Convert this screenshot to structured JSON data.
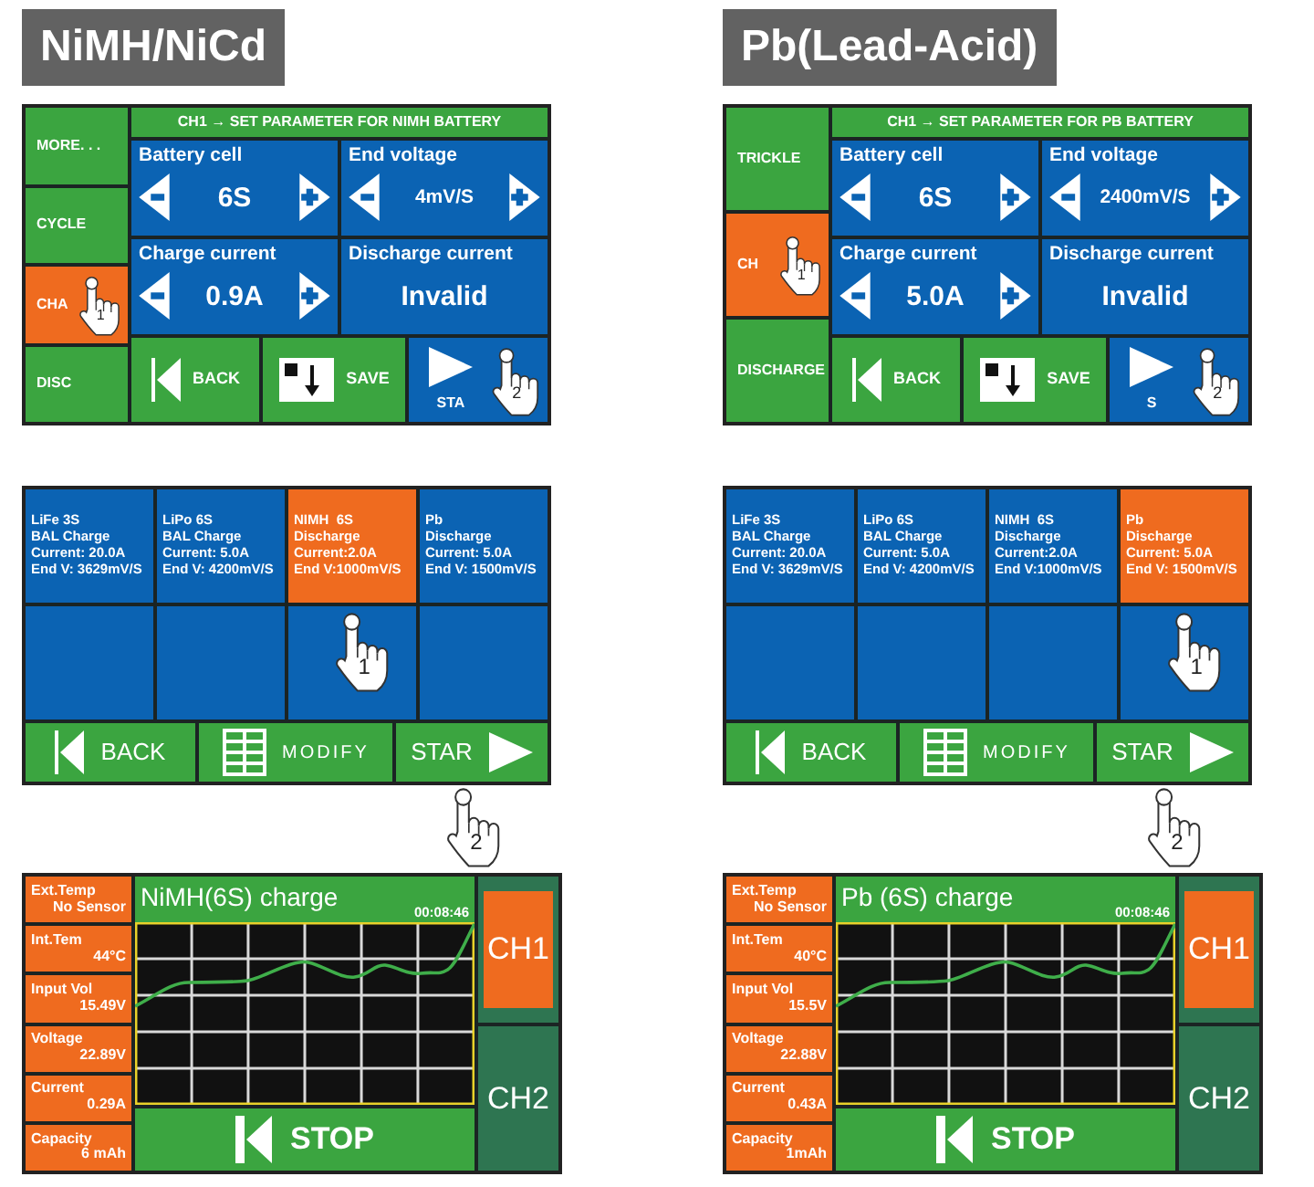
{
  "panels": [
    {
      "heading": "NiMH/NiCd",
      "setup": {
        "header": "CH1 → SET PARAMETER FOR NIMH BATTERY",
        "modes": [
          {
            "label": "MORE. . .",
            "selected": false
          },
          {
            "label": "CYCLE",
            "selected": false
          },
          {
            "label": "CHA",
            "selected": true,
            "step": "1"
          },
          {
            "label": "DISC",
            "selected": false
          }
        ],
        "parameters": [
          {
            "kind": "stepper",
            "label": "Battery cell",
            "value": "6S"
          },
          {
            "kind": "stepper",
            "label": "End voltage",
            "value": "4mV/S"
          },
          {
            "kind": "stepper",
            "label": "Charge current",
            "value": "0.9A"
          },
          {
            "kind": "readout",
            "label": "Discharge current",
            "value": "Invalid"
          }
        ],
        "buttons": [
          {
            "kind": "back",
            "label": "BACK"
          },
          {
            "kind": "save",
            "label": "SAVE"
          },
          {
            "kind": "start",
            "label": "STA",
            "step": "2"
          }
        ]
      },
      "programs": {
        "slots": [
          {
            "lines": [
              "LiFe 3S",
              "BAL Charge",
              "Current: 20.0A",
              "End V: 3629mV/S"
            ],
            "selected": false
          },
          {
            "lines": [
              "LiPo 6S",
              "BAL Charge",
              "Current: 5.0A",
              "End V: 4200mV/S"
            ],
            "selected": false
          },
          {
            "lines": [
              "NIMH  6S",
              "Discharge",
              "Current:2.0A",
              "End V:1000mV/S"
            ],
            "selected": true,
            "step": "1"
          },
          {
            "lines": [
              "Pb",
              "Discharge",
              "Current: 5.0A",
              "End V: 1500mV/S"
            ],
            "selected": false
          },
          {
            "selected": false
          },
          {
            "selected": false
          },
          {
            "selected": false
          },
          {
            "selected": false
          }
        ],
        "buttons": [
          {
            "kind": "back",
            "label": "BACK"
          },
          {
            "kind": "modify",
            "label": "MODIFY"
          },
          {
            "kind": "start",
            "label": "STAR",
            "step": "2"
          }
        ]
      },
      "monitor": {
        "title": "NiMH(6S) charge",
        "elapsed": "00:08:46",
        "readings": [
          {
            "label": "Ext.Temp",
            "value": "No Sensor"
          },
          {
            "label": "Int.Tem",
            "value": "44°C"
          },
          {
            "label": "Input Vol",
            "value": "15.49V"
          },
          {
            "label": "Voltage",
            "value": "22.89V"
          },
          {
            "label": "Current",
            "value": "0.29A"
          },
          {
            "label": "Capacity",
            "value": "6 mAh"
          }
        ],
        "stop": "STOP",
        "channels": [
          {
            "label": "CH1",
            "selected": true
          },
          {
            "label": "CH2",
            "selected": false
          }
        ]
      }
    },
    {
      "heading": "Pb(Lead-Acid)",
      "setup": {
        "header": "CH1 → SET PARAMETER FOR PB BATTERY",
        "modes": [
          {
            "label": "TRICKLE",
            "selected": false
          },
          {
            "label": "CH",
            "selected": true,
            "step": "1"
          },
          {
            "label": "DISCHARGE",
            "selected": false
          }
        ],
        "parameters": [
          {
            "kind": "stepper",
            "label": "Battery cell",
            "value": "6S"
          },
          {
            "kind": "stepper",
            "label": "End voltage",
            "value": "2400mV/S"
          },
          {
            "kind": "stepper",
            "label": "Charge current",
            "value": "5.0A"
          },
          {
            "kind": "readout",
            "label": "Discharge current",
            "value": "Invalid"
          }
        ],
        "buttons": [
          {
            "kind": "back",
            "label": "BACK"
          },
          {
            "kind": "save",
            "label": "SAVE"
          },
          {
            "kind": "start",
            "label": "S",
            "step": "2"
          }
        ]
      },
      "programs": {
        "slots": [
          {
            "lines": [
              "LiFe 3S",
              "BAL Charge",
              "Current: 20.0A",
              "End V: 3629mV/S"
            ],
            "selected": false
          },
          {
            "lines": [
              "LiPo 6S",
              "BAL Charge",
              "Current: 5.0A",
              "End V: 4200mV/S"
            ],
            "selected": false
          },
          {
            "lines": [
              "NIMH  6S",
              "Discharge",
              "Current:2.0A",
              "End V:1000mV/S"
            ],
            "selected": false
          },
          {
            "lines": [
              "Pb",
              "Discharge",
              "Current: 5.0A",
              "End V: 1500mV/S"
            ],
            "selected": true,
            "step": "1"
          },
          {
            "selected": false
          },
          {
            "selected": false
          },
          {
            "selected": false
          },
          {
            "selected": false
          }
        ],
        "buttons": [
          {
            "kind": "back",
            "label": "BACK"
          },
          {
            "kind": "modify",
            "label": "MODIFY"
          },
          {
            "kind": "start",
            "label": "STAR",
            "step": "2"
          }
        ]
      },
      "monitor": {
        "title": "Pb (6S) charge",
        "elapsed": "00:08:46",
        "readings": [
          {
            "label": "Ext.Temp",
            "value": "No Sensor"
          },
          {
            "label": "Int.Tem",
            "value": "40°C"
          },
          {
            "label": "Input Vol",
            "value": "15.5V"
          },
          {
            "label": "Voltage",
            "value": "22.88V"
          },
          {
            "label": "Current",
            "value": "0.43A"
          },
          {
            "label": "Capacity",
            "value": "1mAh"
          }
        ],
        "stop": "STOP",
        "channels": [
          {
            "label": "CH1",
            "selected": true
          },
          {
            "label": "CH2",
            "selected": false
          }
        ]
      }
    }
  ]
}
